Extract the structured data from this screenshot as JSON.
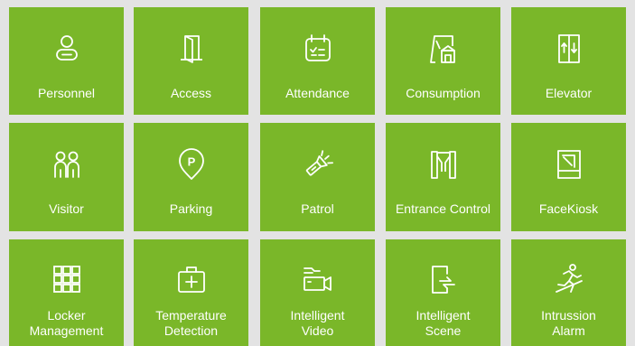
{
  "tiles": [
    {
      "label": "Personnel",
      "icon": "person-icon"
    },
    {
      "label": "Access",
      "icon": "door-icon"
    },
    {
      "label": "Attendance",
      "icon": "calendar-check-icon"
    },
    {
      "label": "Consumption",
      "icon": "store-icon"
    },
    {
      "label": "Elevator",
      "icon": "elevator-icon"
    },
    {
      "label": "Visitor",
      "icon": "visitors-icon"
    },
    {
      "label": "Parking",
      "icon": "parking-pin-icon"
    },
    {
      "label": "Patrol",
      "icon": "flashlight-icon"
    },
    {
      "label": "Entrance Control",
      "icon": "turnstile-icon"
    },
    {
      "label": "FaceKiosk",
      "icon": "kiosk-icon"
    },
    {
      "label_line1": "Locker",
      "label_line2": "Management",
      "icon": "locker-grid-icon"
    },
    {
      "label_line1": "Temperature",
      "label_line2": "Detection",
      "icon": "medical-kit-icon"
    },
    {
      "label_line1": "Intelligent",
      "label_line2": "Video",
      "icon": "video-camera-icon"
    },
    {
      "label_line1": "Intelligent",
      "label_line2": "Scene",
      "icon": "scene-icon"
    },
    {
      "label_line1": "Intrussion",
      "label_line2": "Alarm",
      "icon": "intruder-icon"
    }
  ],
  "colors": {
    "tile": "#7ab729",
    "background": "#e3e3e3",
    "text": "#ffffff"
  }
}
